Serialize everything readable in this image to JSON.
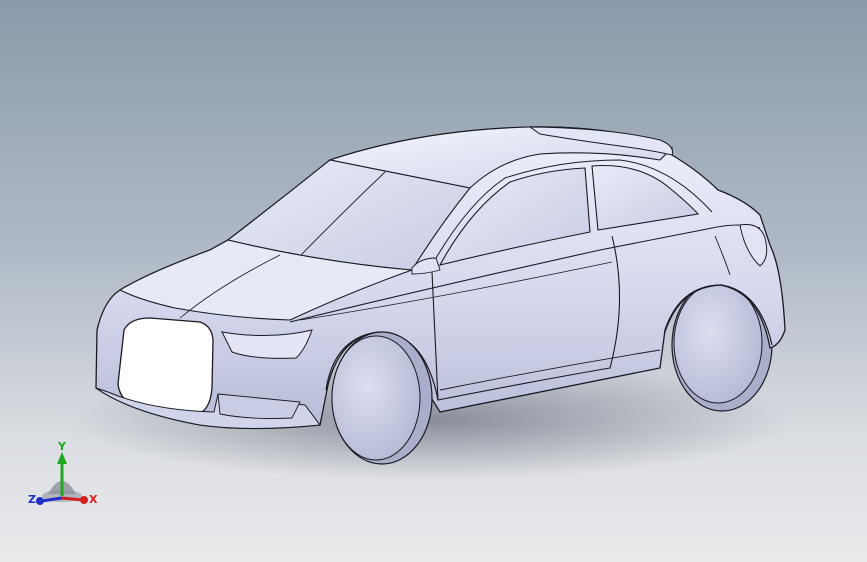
{
  "viewport": {
    "background_top": "#8b9aab",
    "background_bottom": "#e9eaec",
    "model_fill": "#dcdff2",
    "model_edge": "#1a1a22"
  },
  "triad": {
    "x_label": "X",
    "y_label": "Y",
    "z_label": "Z",
    "x_color": "#d42020",
    "y_color": "#1fa81f",
    "z_color": "#2030c8"
  }
}
